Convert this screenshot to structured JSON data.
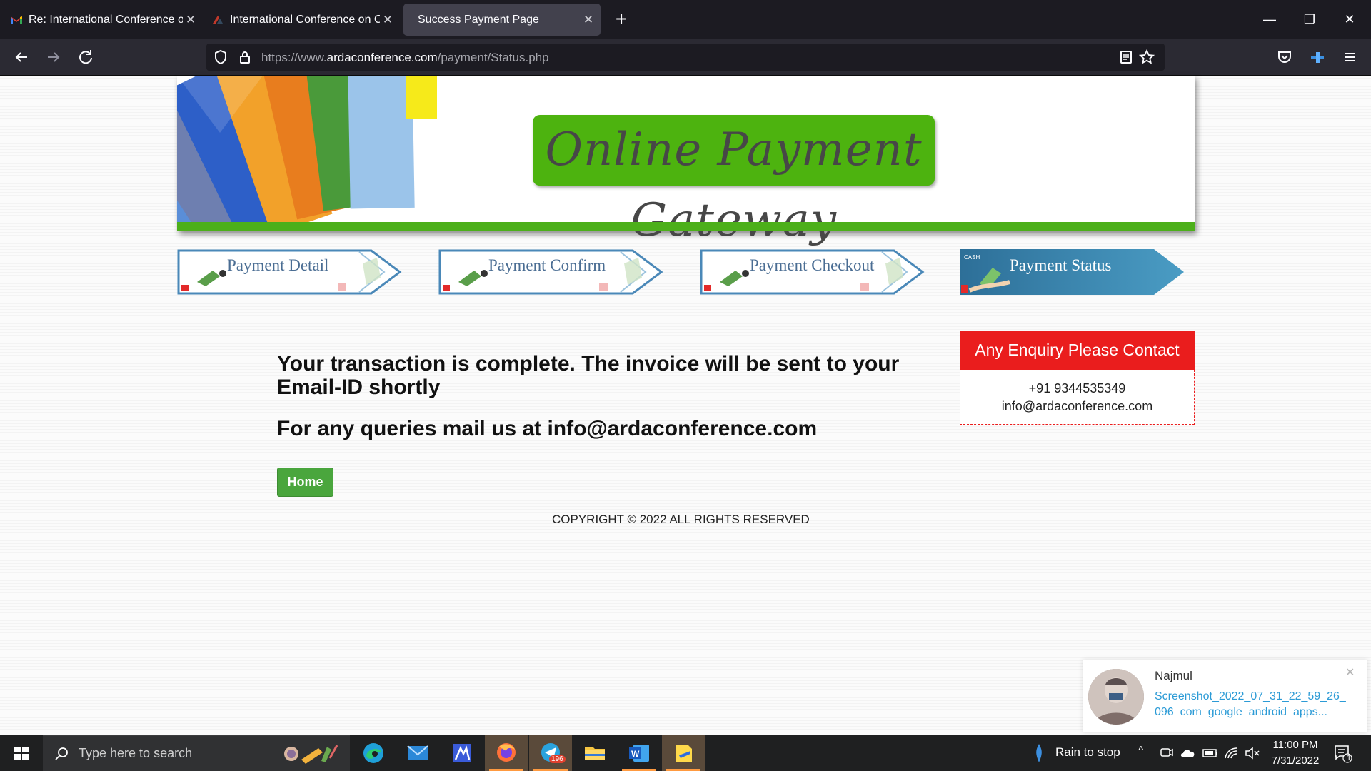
{
  "browser": {
    "tabs": [
      {
        "title": "Re: International Conference on",
        "favicon": "gmail-icon"
      },
      {
        "title": "International Conference on Co",
        "favicon": "arda-logo-icon"
      },
      {
        "title": "Success Payment Page",
        "favicon": "none",
        "active": true
      }
    ],
    "url_prefix": "https://www.",
    "url_domain": "ardaconference.com",
    "url_path": "/payment/Status.php"
  },
  "page": {
    "gateway_title": "Online Payment Gateway",
    "steps": [
      {
        "label": "Payment Detail",
        "active": false
      },
      {
        "label": "Payment Confirm",
        "active": false
      },
      {
        "label": "Payment Checkout",
        "active": false
      },
      {
        "label": "Payment Status",
        "active": true
      }
    ],
    "message": "Your transaction is complete. The invoice will be sent to your Email-ID shortly",
    "query_message": "For any queries mail us at info@ardaconference.com",
    "home_label": "Home",
    "copyright": "COPYRIGHT © 2022 ALL RIGHTS RESERVED",
    "enquiry": {
      "title": "Any Enquiry Please Contact",
      "phone": "+91 9344535349",
      "email": "info@ardaconference.com"
    }
  },
  "notification": {
    "sender": "Najmul",
    "file": "Screenshot_2022_07_31_22_59_26_096_com_google_android_apps..."
  },
  "taskbar": {
    "search_placeholder": "Type here to search",
    "weather": "Rain to stop",
    "time": "11:00 PM",
    "date": "7/31/2022",
    "telegram_badge": "196",
    "notif_count": "1"
  },
  "colors": {
    "gateway_green": "#4db30f",
    "enquiry_red": "#ea1d1d",
    "home_green": "#4aa63d",
    "step_label": "#4a6d93",
    "active_step": "#3b83a8"
  }
}
